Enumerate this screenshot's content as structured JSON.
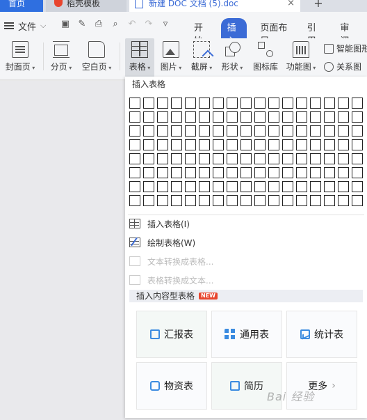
{
  "tabs": {
    "home": "首页",
    "templates": "稻壳模板",
    "doc": "新建 DOC 文档 (5).doc",
    "close_glyph": "×",
    "add_glyph": "+"
  },
  "menubar": {
    "file_label": "文件",
    "file_arrow": "⌵",
    "tabs": [
      "开始",
      "插入",
      "页面布局",
      "引用",
      "审阅"
    ],
    "active_tab": "插入"
  },
  "ribbon": {
    "cover": "封面页",
    "page_break": "分页",
    "blank_page": "空白页",
    "table": "表格",
    "picture": "图片",
    "screenshot": "截屏",
    "shape": "形状",
    "icon_library": "图标库",
    "function_chart": "功能图",
    "smart_graphic": "智能图形",
    "relationship": "关系图"
  },
  "panel": {
    "header": "插入表格",
    "grid_cols": 17,
    "grid_rows": 8,
    "items": [
      {
        "label": "插入表格(I)",
        "enabled": true
      },
      {
        "label": "绘制表格(W)",
        "enabled": true
      },
      {
        "label": "文本转换成表格...",
        "enabled": false
      },
      {
        "label": "表格转换成文本...",
        "enabled": false
      }
    ],
    "section_title": "插入内容型表格",
    "new_badge": "NEW",
    "cards": [
      {
        "label": "汇报表"
      },
      {
        "label": "通用表"
      },
      {
        "label": "统计表"
      },
      {
        "label": "物资表"
      },
      {
        "label": "简历"
      },
      {
        "label": "更多"
      }
    ]
  },
  "watermark": "Bai 经验"
}
